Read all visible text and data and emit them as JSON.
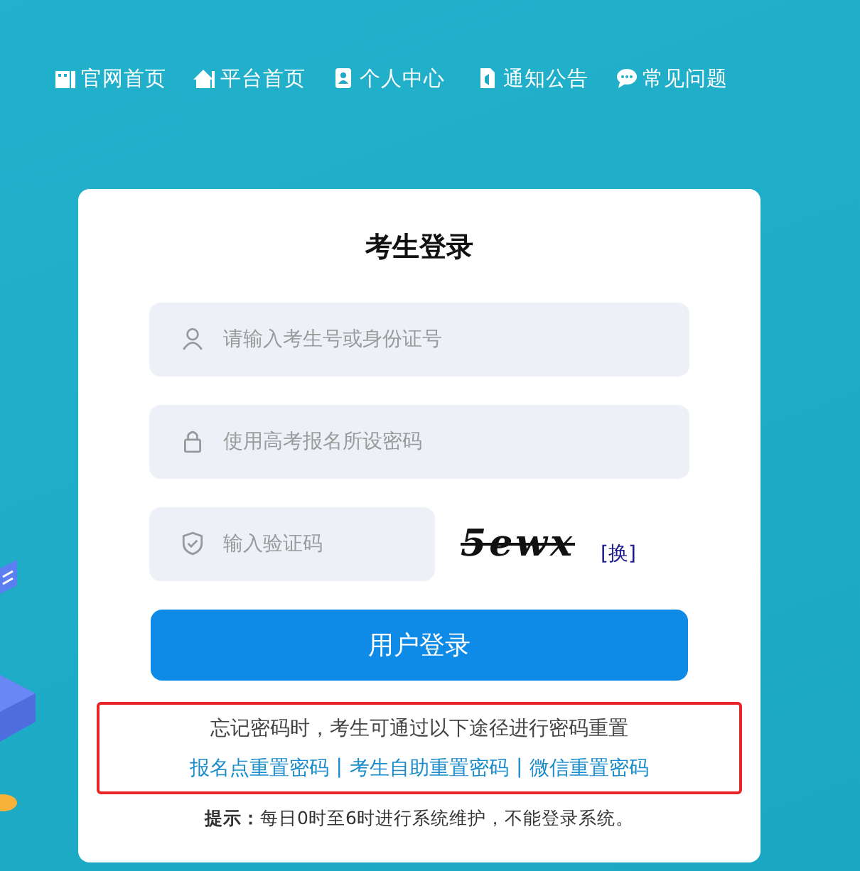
{
  "nav": [
    {
      "kind": "building",
      "label": "官网首页"
    },
    {
      "kind": "home",
      "label": "平台首页"
    },
    {
      "kind": "contact",
      "label": "个人中心"
    },
    {
      "kind": "file",
      "label": "通知公告"
    },
    {
      "kind": "chat",
      "label": "常见问题"
    }
  ],
  "login": {
    "title": "考生登录",
    "fields": [
      {
        "kind": "user",
        "placeholder": "请输入考生号或身份证号"
      },
      {
        "kind": "password",
        "placeholder": "使用高考报名所设密码"
      }
    ],
    "captcha": {
      "placeholder": "输入验证码",
      "code": "5ewx",
      "refresh": "[换]"
    },
    "submit": "用户登录",
    "reset": {
      "note": "忘记密码时，考生可通过以下途径进行密码重置",
      "separator": "|",
      "links": [
        "报名点重置密码",
        "考生自助重置密码",
        "微信重置密码"
      ]
    },
    "tip": "**提示：**每日0时至6时进行系统维护，不能登录系统。"
  }
}
